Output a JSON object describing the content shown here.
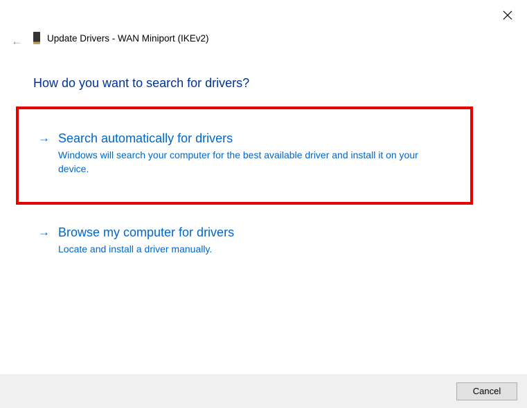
{
  "window": {
    "title": "Update Drivers - WAN Miniport (IKEv2)"
  },
  "heading": "How do you want to search for drivers?",
  "options": [
    {
      "title": "Search automatically for drivers",
      "description": "Windows will search your computer for the best available driver and install it on your device."
    },
    {
      "title": "Browse my computer for drivers",
      "description": "Locate and install a driver manually."
    }
  ],
  "buttons": {
    "cancel": "Cancel"
  }
}
